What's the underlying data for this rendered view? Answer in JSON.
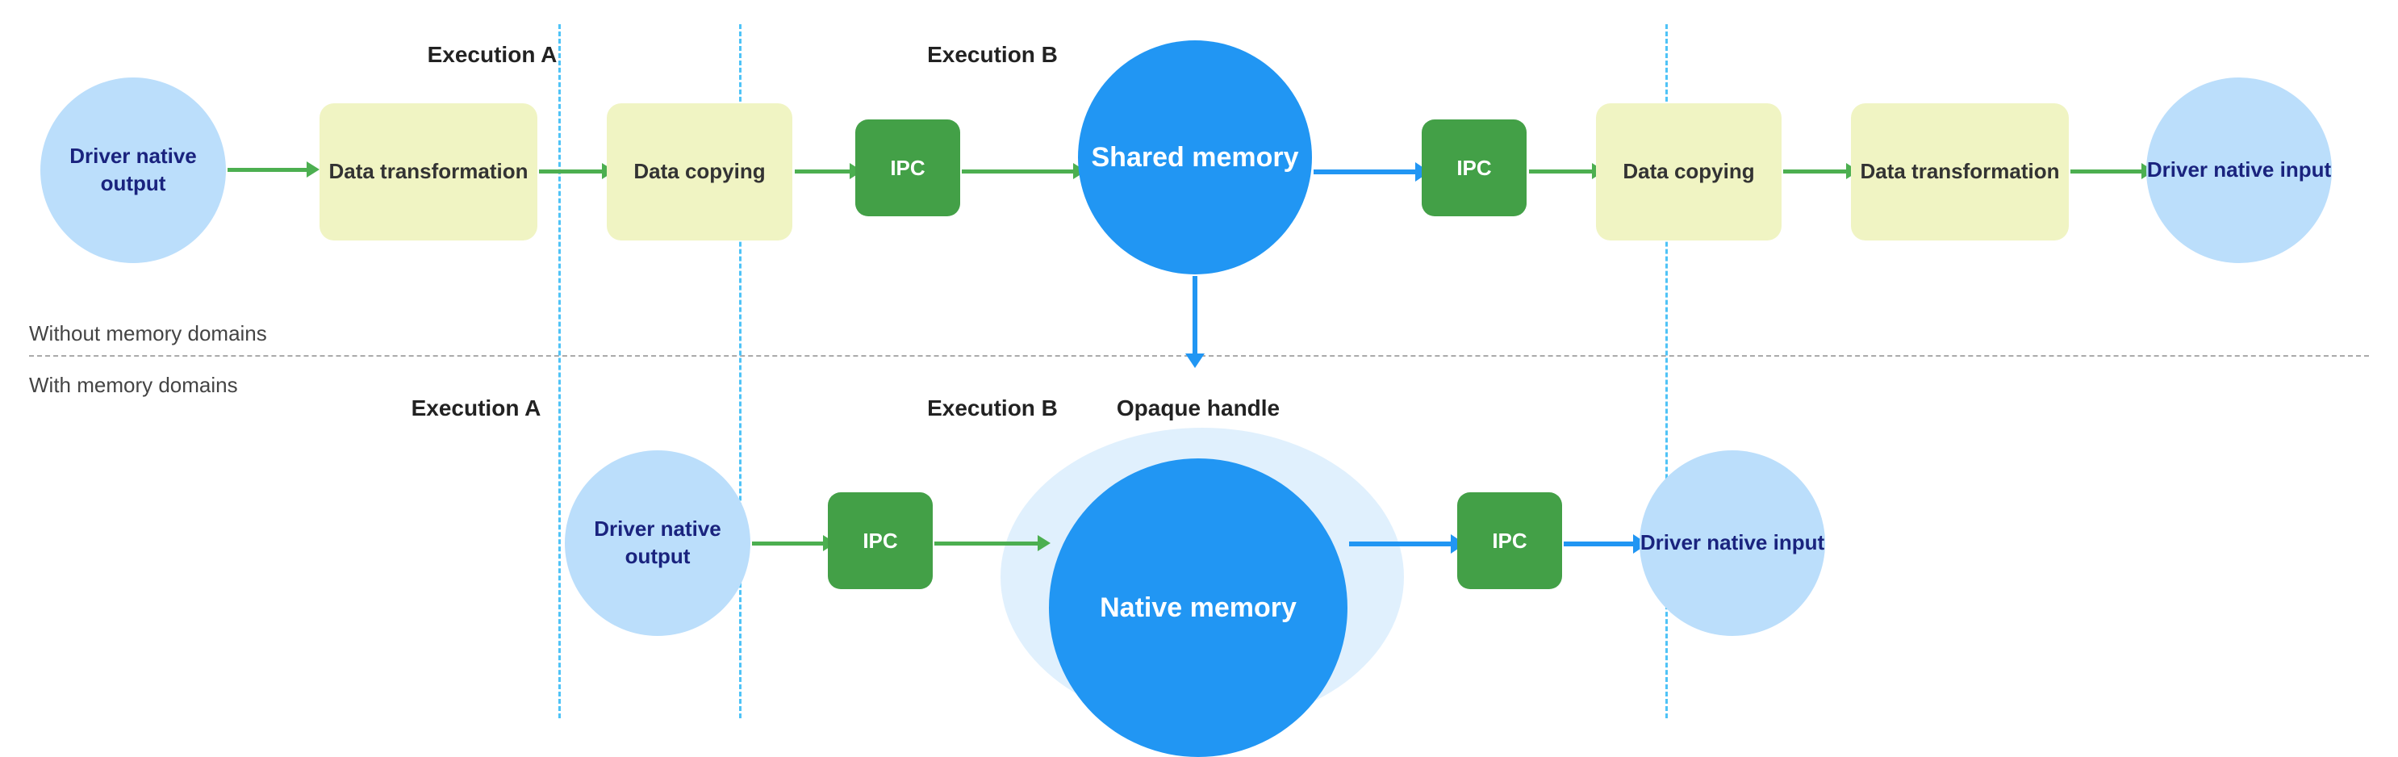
{
  "sections": {
    "without_label": "Without memory domains",
    "with_label": "With memory domains"
  },
  "top_row": {
    "exec_a_label": "Execution A",
    "exec_b_label": "Execution B",
    "nodes": [
      {
        "id": "driver-native-output-top",
        "text": "Driver native output",
        "type": "circle",
        "color": "light-blue"
      },
      {
        "id": "data-transform-1",
        "text": "Data transformation",
        "type": "rect",
        "color": "light-green"
      },
      {
        "id": "data-copy-1",
        "text": "Data copying",
        "type": "rect",
        "color": "light-green"
      },
      {
        "id": "ipc-1",
        "text": "IPC",
        "type": "rect",
        "color": "green"
      },
      {
        "id": "shared-memory",
        "text": "Shared memory",
        "type": "circle",
        "color": "blue"
      },
      {
        "id": "ipc-2",
        "text": "IPC",
        "type": "rect",
        "color": "green"
      },
      {
        "id": "data-copy-2",
        "text": "Data copying",
        "type": "rect",
        "color": "light-green"
      },
      {
        "id": "data-transform-2",
        "text": "Data transformation",
        "type": "rect",
        "color": "light-green"
      },
      {
        "id": "driver-native-input-top",
        "text": "Driver native input",
        "type": "circle",
        "color": "light-blue"
      }
    ]
  },
  "bottom_row": {
    "exec_a_label": "Execution A",
    "exec_b_label": "Execution B",
    "opaque_label": "Opaque handle",
    "nodes": [
      {
        "id": "driver-native-output-bot",
        "text": "Driver native output",
        "type": "circle",
        "color": "light-blue"
      },
      {
        "id": "ipc-bot-1",
        "text": "IPC",
        "type": "rect",
        "color": "green"
      },
      {
        "id": "native-memory",
        "text": "Native memory",
        "type": "circle-large",
        "color": "blue"
      },
      {
        "id": "ipc-bot-2",
        "text": "IPC",
        "type": "rect",
        "color": "green"
      },
      {
        "id": "driver-native-input-bot",
        "text": "Driver native input",
        "type": "circle",
        "color": "light-blue"
      }
    ]
  }
}
